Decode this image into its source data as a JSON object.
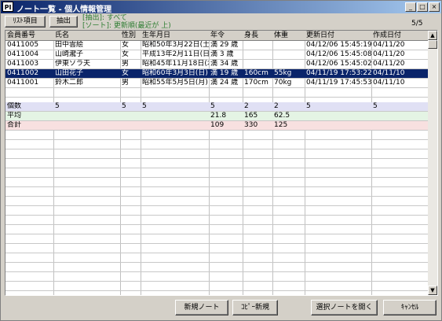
{
  "window": {
    "title": "ノート一覧 - 個人情報管理",
    "icon_text": "PI",
    "controls": [
      "_",
      "□",
      "×"
    ]
  },
  "toolbar": {
    "list_items_label": "ﾘｽﾄ項目",
    "extract_label": "抽出",
    "extract_info": "[抽出]: すべて",
    "sort_info": "[ソート]: 更新順(最近が 上)",
    "count": "5/5"
  },
  "table": {
    "columns": [
      "会員番号",
      "氏名",
      "性別",
      "生年月日",
      "年令",
      "身長",
      "体重",
      "更新日付",
      "作成日付"
    ],
    "rows": [
      [
        "0411005",
        "田中雲絵",
        "女",
        "昭和50年3月22日(土",
        "満 29 歳",
        "",
        "",
        "04/12/06 15:45:19",
        "04/11/20"
      ],
      [
        "0411004",
        "山崎瀧子",
        "女",
        "平成13年2月11日(日",
        "満 3 歳",
        "",
        "",
        "04/12/06 15:45:08",
        "04/11/20"
      ],
      [
        "0411003",
        "伊東ソラ夫",
        "男",
        "昭和45年11月18日(水",
        "満 34 歳",
        "",
        "",
        "04/12/06 15:45:02",
        "04/11/20"
      ],
      [
        "0411002",
        "山田花子",
        "女",
        "昭和60年3月3日(日)",
        "満 19 歳",
        "160cm",
        "55kg",
        "04/11/19 17:53:22",
        "04/11/10"
      ],
      [
        "0411001",
        "鈴木二郎",
        "男",
        "昭和55年5月5日(月)",
        "満 24 歳",
        "170cm",
        "70kg",
        "04/11/19 17:45:53",
        "04/11/10"
      ]
    ],
    "selected_row": 3,
    "stats": {
      "count": [
        "個数",
        "5",
        "5",
        "5",
        "5",
        "2",
        "2",
        "5",
        "5"
      ],
      "avg": [
        "平均",
        "",
        "",
        "",
        "21.8",
        "165",
        "62.5",
        "",
        ""
      ],
      "sum": [
        "合計",
        "",
        "",
        "",
        "109",
        "330",
        "125",
        "",
        ""
      ]
    }
  },
  "footer": {
    "new_note_label": "新規ノート",
    "copy_new_label": "ｺﾋﾟｰ新規",
    "open_selected_label": "選択ノートを開く",
    "cancel_label": "ｷｬﾝｾﾙ"
  },
  "colors": {
    "titlebar_start": "#0a246a",
    "titlebar_end": "#a6caf0",
    "selected_row": "#0a246a",
    "info_text": "#2e7d32",
    "count_row": "#e0e0f4",
    "avg_row": "#e4f4e4",
    "sum_row": "#f8e0e0"
  }
}
